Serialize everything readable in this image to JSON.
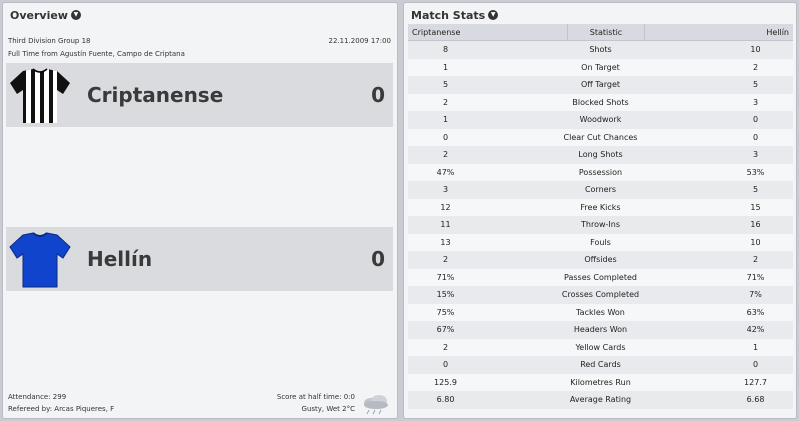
{
  "overview": {
    "title": "Overview",
    "competition": "Third Division Group 18",
    "datetime": "22.11.2009 17:00",
    "venue_line": "Full Time from Agustín Fuente, Campo de Criptana",
    "home": {
      "name": "Criptanense",
      "score": "0",
      "shirt_colors": [
        "#111111",
        "#ffffff"
      ]
    },
    "away": {
      "name": "Hellín",
      "score": "0",
      "shirt_colors": [
        "#1144cc",
        "#0b2a80"
      ]
    },
    "attendance": "Attendance: 299",
    "referee": "Refereed by: Arcas Piqueres, F",
    "halftime": "Score at half time: 0:0",
    "weather": "Gusty, Wet 2°C",
    "weather_icon": "rain-cloud-icon"
  },
  "stats": {
    "title": "Match Stats",
    "header": {
      "home": "Criptanense",
      "statistic": "Statistic",
      "away": "Hellín"
    },
    "rows": [
      {
        "home": "8",
        "label": "Shots",
        "away": "10"
      },
      {
        "home": "1",
        "label": "On Target",
        "away": "2"
      },
      {
        "home": "5",
        "label": "Off Target",
        "away": "5"
      },
      {
        "home": "2",
        "label": "Blocked Shots",
        "away": "3"
      },
      {
        "home": "1",
        "label": "Woodwork",
        "away": "0"
      },
      {
        "home": "0",
        "label": "Clear Cut Chances",
        "away": "0"
      },
      {
        "home": "2",
        "label": "Long Shots",
        "away": "3"
      },
      {
        "home": "47%",
        "label": "Possession",
        "away": "53%"
      },
      {
        "home": "3",
        "label": "Corners",
        "away": "5"
      },
      {
        "home": "12",
        "label": "Free Kicks",
        "away": "15"
      },
      {
        "home": "11",
        "label": "Throw-Ins",
        "away": "16"
      },
      {
        "home": "13",
        "label": "Fouls",
        "away": "10"
      },
      {
        "home": "2",
        "label": "Offsides",
        "away": "2"
      },
      {
        "home": "71%",
        "label": "Passes Completed",
        "away": "71%"
      },
      {
        "home": "15%",
        "label": "Crosses Completed",
        "away": "7%"
      },
      {
        "home": "75%",
        "label": "Tackles Won",
        "away": "63%"
      },
      {
        "home": "67%",
        "label": "Headers Won",
        "away": "42%"
      },
      {
        "home": "2",
        "label": "Yellow Cards",
        "away": "1"
      },
      {
        "home": "0",
        "label": "Red Cards",
        "away": "0"
      },
      {
        "home": "125.9",
        "label": "Kilometres Run",
        "away": "127.7"
      },
      {
        "home": "6.80",
        "label": "Average Rating",
        "away": "6.68"
      }
    ]
  }
}
